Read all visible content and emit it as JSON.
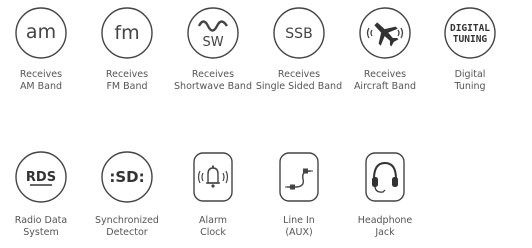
{
  "features": [
    {
      "icon": "am-icon",
      "glyph": "am",
      "label": "Receives\nAM Band"
    },
    {
      "icon": "fm-icon",
      "glyph": "fm",
      "label": "Receives\nFM Band"
    },
    {
      "icon": "shortwave-icon",
      "glyph": "SW",
      "label": "Receives\nShortwave Band"
    },
    {
      "icon": "ssb-icon",
      "glyph": "SSB",
      "label": "Receives\nSingle Sided Band"
    },
    {
      "icon": "aircraft-icon",
      "label": "Receives\nAircraft Band"
    },
    {
      "icon": "digital-tuning-icon",
      "glyph_line1": "DIGITAL",
      "glyph_line2": "TUNING",
      "label": "Digital\nTuning"
    },
    {
      "icon": "rds-icon",
      "glyph": "RDS",
      "label": "Radio Data\nSystem"
    },
    {
      "icon": "synchronized-detector-icon",
      "glyph": ":SD:",
      "label": "Synchronized\nDetector"
    },
    {
      "icon": "alarm-clock-icon",
      "label": "Alarm\nClock"
    },
    {
      "icon": "line-in-icon",
      "label": "Line In\n(AUX)"
    },
    {
      "icon": "headphone-jack-icon",
      "label": "Headphone\nJack"
    }
  ]
}
